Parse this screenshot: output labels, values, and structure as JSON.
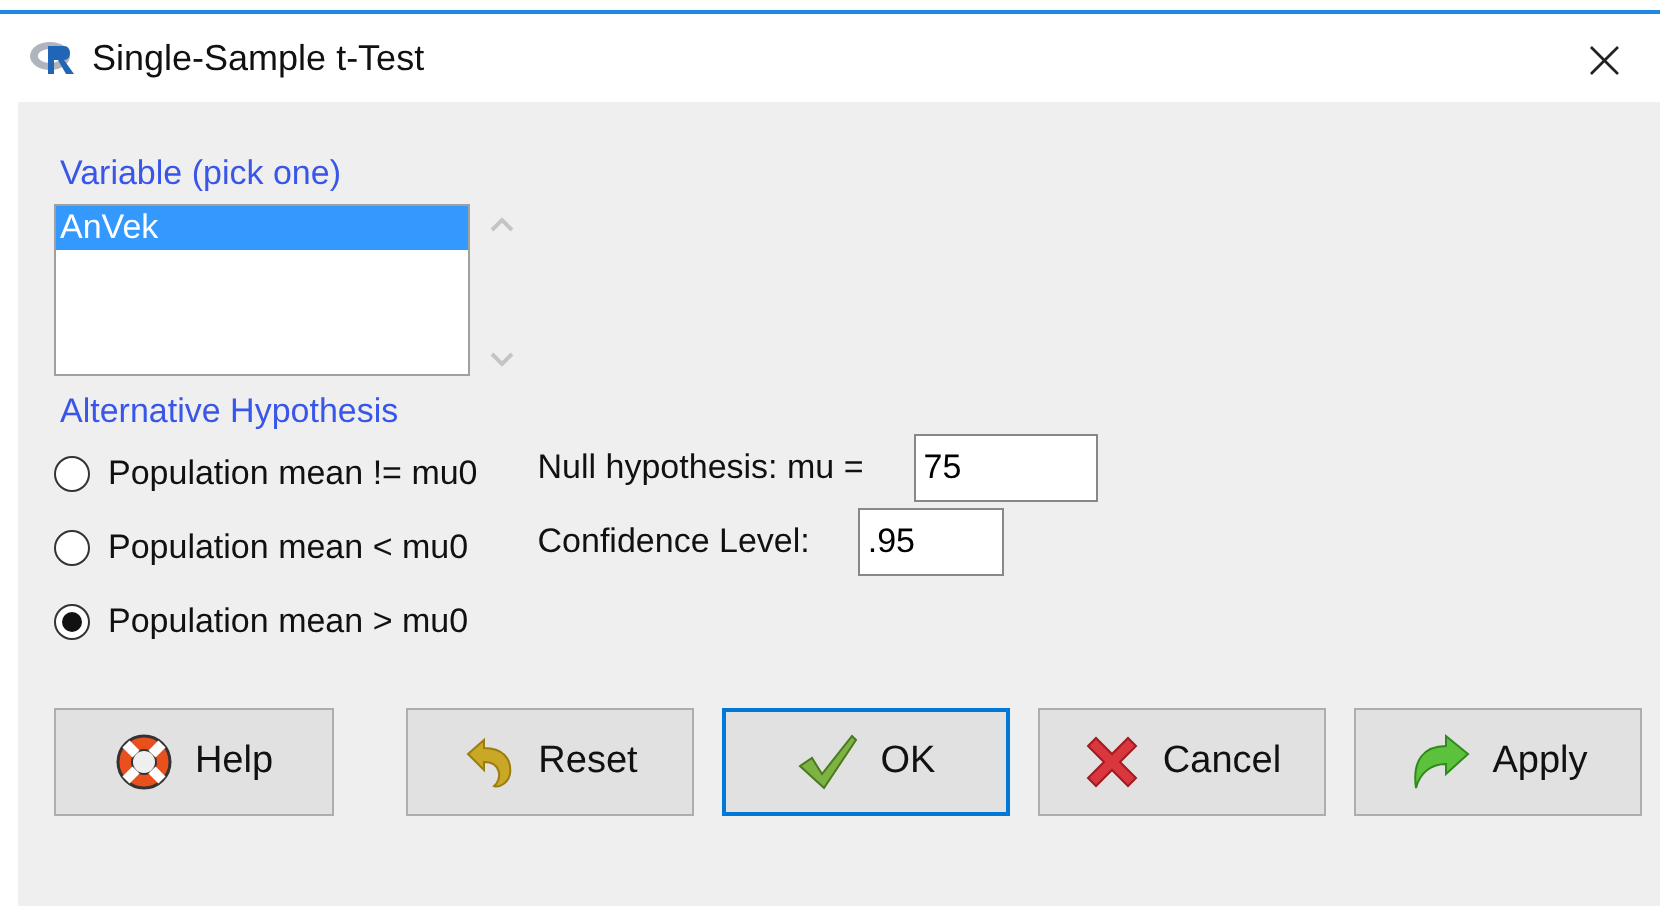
{
  "window": {
    "title": "Single-Sample t-Test",
    "close": "×"
  },
  "variable": {
    "label": "Variable (pick one)",
    "items": [
      {
        "text": "AnVek",
        "selected": true
      }
    ]
  },
  "alternative": {
    "label": "Alternative Hypothesis",
    "options": [
      {
        "text": "Population mean != mu0",
        "selected": false
      },
      {
        "text": "Population mean < mu0",
        "selected": false
      },
      {
        "text": "Population mean > mu0",
        "selected": true
      }
    ]
  },
  "fields": [
    {
      "label": "Null hypothesis: mu =",
      "value": "75",
      "kind": "wide"
    },
    {
      "label": "Confidence Level:",
      "value": ".95",
      "kind": "narrow"
    }
  ],
  "buttons": [
    {
      "label": "Help",
      "kind": "help",
      "focused": false
    },
    {
      "label": "Reset",
      "kind": "reset",
      "focused": false
    },
    {
      "label": "OK",
      "kind": "ok",
      "focused": true
    },
    {
      "label": "Cancel",
      "kind": "cancel",
      "focused": false
    },
    {
      "label": "Apply",
      "kind": "apply",
      "focused": false
    }
  ]
}
